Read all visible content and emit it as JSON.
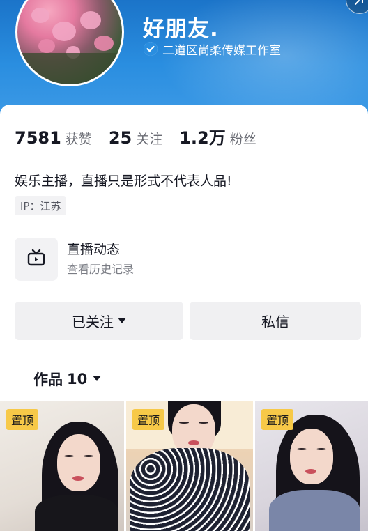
{
  "profile": {
    "nickname": "好朋友.",
    "verified_label": "二道区尚柔传媒工作室"
  },
  "stats": [
    {
      "value": "7581",
      "label": "获赞"
    },
    {
      "value": "25",
      "label": "关注"
    },
    {
      "value": "1.2万",
      "label": "粉丝"
    }
  ],
  "bio": "娱乐主播，直播只是形式不代表人品!",
  "ip_tag": "IP：江苏",
  "live": {
    "title": "直播动态",
    "subtitle": "查看历史记录"
  },
  "actions": {
    "follow_label": "已关注",
    "message_label": "私信"
  },
  "works_tab": {
    "label": "作品",
    "count": "10"
  },
  "thumbnails": [
    {
      "badge": "置顶"
    },
    {
      "badge": "置顶"
    },
    {
      "badge": "置顶"
    }
  ],
  "colors": {
    "header_blue": "#2a8ee0",
    "pin_yellow": "#f7c948",
    "button_gray": "#f0f0f2"
  },
  "icons": {
    "verified": "verified-check-icon",
    "live": "tv-icon",
    "follow_dropdown": "caret-down-icon",
    "tab_dropdown": "caret-down-icon",
    "corner": "share-icon"
  }
}
